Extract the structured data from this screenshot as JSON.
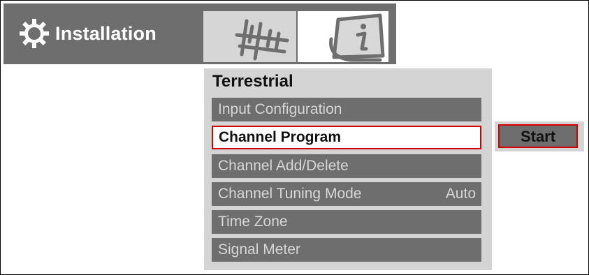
{
  "header": {
    "title": "Installation",
    "icons": [
      "gear-icon",
      "antenna-icon",
      "info-icon"
    ]
  },
  "panel": {
    "title": "Terrestrial",
    "items": [
      {
        "label": "Input Configuration",
        "value": ""
      },
      {
        "label": "Channel Program",
        "value": "",
        "selected": true
      },
      {
        "label": "Channel Add/Delete",
        "value": ""
      },
      {
        "label": "Channel Tuning Mode",
        "value": "Auto"
      },
      {
        "label": "Time Zone",
        "value": ""
      },
      {
        "label": "Signal Meter",
        "value": ""
      }
    ]
  },
  "action": {
    "start_label": "Start"
  },
  "colors": {
    "bar": "#6e6e6e",
    "panel": "#d4d4d4",
    "highlight": "#d40000"
  }
}
